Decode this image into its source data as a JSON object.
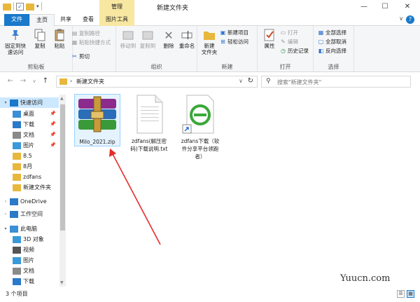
{
  "window": {
    "title": "新建文件夹",
    "context_tab_header": "管理",
    "min_glyph": "—",
    "max_glyph": "☐",
    "close_glyph": "✕",
    "qat_check": "✓",
    "qat_dropdown": "▾"
  },
  "tabs": [
    {
      "label": "文件"
    },
    {
      "label": "主页"
    },
    {
      "label": "共享"
    },
    {
      "label": "查看"
    },
    {
      "label": "图片工具"
    }
  ],
  "ribbon_collapse": "∨",
  "help": "?",
  "ribbon": {
    "clipboard": {
      "label": "剪贴板",
      "pin": "固定到快\n速访问",
      "copy": "复制",
      "paste": "粘贴",
      "copy_path": "复制路径",
      "paste_shortcut": "粘贴快捷方式",
      "cut": "剪切"
    },
    "organize": {
      "label": "组织",
      "move_to": "移动到",
      "copy_to": "复制到",
      "delete": "删除",
      "rename": "重命名"
    },
    "new": {
      "label": "新建",
      "new_folder": "新建\n文件夹",
      "new_item": "新建项目",
      "easy_access": "轻松访问"
    },
    "open": {
      "label": "打开",
      "properties": "属性",
      "open": "打开",
      "edit": "编辑",
      "history": "历史记录"
    },
    "select": {
      "label": "选择",
      "select_all": "全部选择",
      "select_none": "全部取消",
      "invert": "反向选择"
    }
  },
  "address": {
    "back": "←",
    "forward": "→",
    "dropdown": "∨",
    "up": "↑",
    "chevron": "›",
    "path": "新建文件夹",
    "path_dropdown": "∨",
    "refresh": "↻",
    "search_placeholder": "搜索\"新建文件夹\""
  },
  "nav": [
    {
      "label": "快速访问",
      "pinned": false,
      "icon": "star-icon",
      "color": "#1979ca"
    },
    {
      "label": "桌面",
      "pinned": true,
      "icon": "desktop-icon",
      "color": "#3b8fd6"
    },
    {
      "label": "下载",
      "pinned": true,
      "icon": "download-icon",
      "color": "#2b79c9"
    },
    {
      "label": "文档",
      "pinned": true,
      "icon": "document-icon",
      "color": "#8a8a8a"
    },
    {
      "label": "图片",
      "pinned": true,
      "icon": "pictures-icon",
      "color": "#3a9ad9"
    },
    {
      "label": "8.5",
      "pinned": false,
      "icon": "folder-icon",
      "color": "#e8b73c"
    },
    {
      "label": "8月",
      "pinned": false,
      "icon": "folder-icon",
      "color": "#e8b73c"
    },
    {
      "label": "zdfans",
      "pinned": false,
      "icon": "folder-icon",
      "color": "#e8b73c"
    },
    {
      "label": "新建文件夹",
      "pinned": false,
      "icon": "folder-icon",
      "color": "#e8b73c"
    },
    {
      "label": "OneDrive",
      "pinned": false,
      "icon": "cloud-icon",
      "color": "#2b79c9"
    },
    {
      "label": "工作空间",
      "pinned": false,
      "icon": "workspace-icon",
      "color": "#2b79c9"
    },
    {
      "label": "此电脑",
      "pinned": false,
      "icon": "computer-icon",
      "color": "#3b8fd6"
    },
    {
      "label": "3D 对象",
      "pinned": false,
      "icon": "3d-objects-icon",
      "color": "#3a9ad9"
    },
    {
      "label": "视频",
      "pinned": false,
      "icon": "video-icon",
      "color": "#555555"
    },
    {
      "label": "图片",
      "pinned": false,
      "icon": "pictures-icon",
      "color": "#3a9ad9"
    },
    {
      "label": "文档",
      "pinned": false,
      "icon": "document-icon",
      "color": "#8a8a8a"
    },
    {
      "label": "下载",
      "pinned": false,
      "icon": "download-icon",
      "color": "#2b79c9"
    }
  ],
  "pin_glyph": "📌",
  "files": [
    {
      "name": "Milo_2021.zip",
      "icon": "winrar-archive-icon",
      "selected": true
    },
    {
      "name": "zdfans(解压密\n码)下载说明.txt",
      "icon": "text-file-icon",
      "selected": false
    },
    {
      "name": "zdfans下载（软\n件分享平台领跑\n者）",
      "icon": "ie-shortcut-icon",
      "selected": false
    }
  ],
  "status": {
    "count": "3 个项目"
  },
  "watermark": "Yuucn.com"
}
